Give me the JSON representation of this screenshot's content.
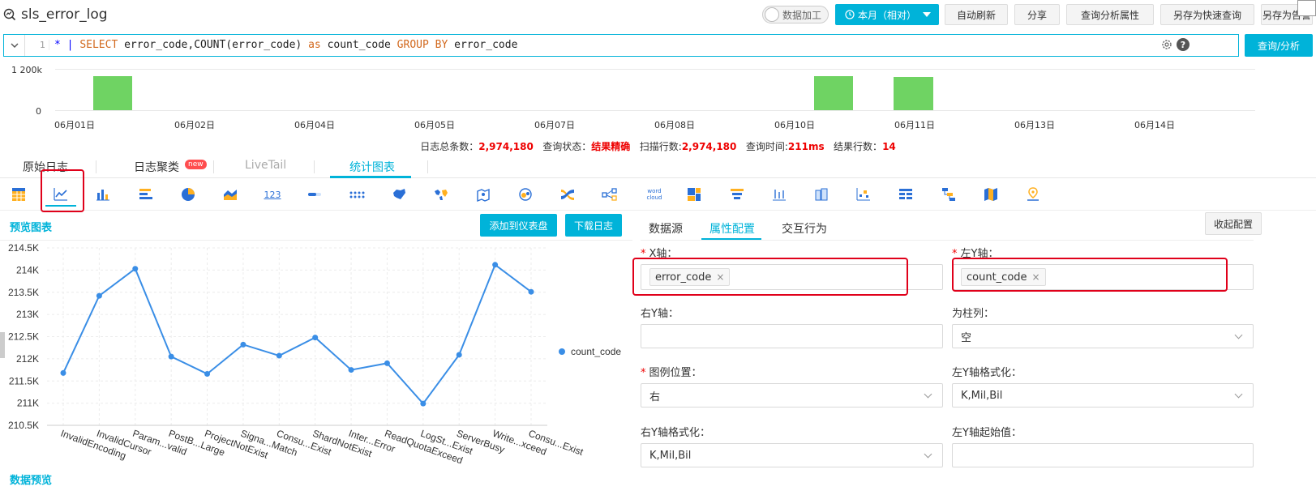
{
  "header": {
    "title": "sls_error_log",
    "toggle_label": "数据加工",
    "time_label": "本月（相对）",
    "buttons": [
      "自动刷新",
      "分享",
      "查询分析属性",
      "另存为快速查询",
      "另存为告警"
    ]
  },
  "query": {
    "line_number": "1",
    "parts": {
      "p1": "* | ",
      "p2": "SELECT",
      "p3": " error_code,COUNT(error_code) ",
      "p4": "as",
      "p5": " count_code ",
      "p6": "GROUP BY",
      "p7": " error_code"
    },
    "help": "?",
    "submit_label": "查询/分析"
  },
  "histogram": {
    "y_labels": [
      "1 200k",
      "0"
    ],
    "x_labels": [
      "06月01日",
      "06月02日",
      "06月04日",
      "06月05日",
      "06月07日",
      "06月08日",
      "06月10日",
      "06月11日",
      "06月13日",
      "06月14日"
    ]
  },
  "stats": {
    "total_label": "日志总条数：",
    "total_value": "2,974,180",
    "status_label": "查询状态：",
    "status_value": "结果精确",
    "scan_label": "扫描行数:",
    "scan_value": "2,974,180",
    "time_label": "查询时间:",
    "time_value": "211ms",
    "rows_label": "结果行数：",
    "rows_value": "14"
  },
  "tabs": {
    "raw": "原始日志",
    "cluster": "日志聚类",
    "cluster_badge": "new",
    "livetail": "LiveTail",
    "charts": "统计图表"
  },
  "chart_type_icons": {
    "number_icon_text": "123",
    "wordcloud_icon_text": "word cloud"
  },
  "preview": {
    "title": "预览图表",
    "add_dashboard": "添加到仪表盘",
    "download_log": "下载日志",
    "data_preview": "数据预览"
  },
  "chart_data": {
    "type": "line",
    "categories": [
      "InvalidEncoding",
      "InvalidCursor",
      "Param...valid",
      "PostB...Large",
      "ProjectNotExist",
      "Signa...Match",
      "Consu...Exist",
      "ShardNotExist",
      "Inter...Error",
      "ReadQuotaExceed",
      "LogSt...Exist",
      "ServerBusy",
      "Write...xceed",
      "Consu...Exist"
    ],
    "y_ticks": [
      "214.5K",
      "214K",
      "213.5K",
      "213K",
      "212.5K",
      "212K",
      "211.5K",
      "211K",
      "210.5K"
    ],
    "ylim": [
      210500,
      214500
    ],
    "series": [
      {
        "name": "count_code",
        "values": [
          211680,
          213420,
          214030,
          212050,
          211660,
          212320,
          212070,
          212480,
          211750,
          211900,
          210990,
          212090,
          214120,
          213510
        ]
      }
    ],
    "legend_position": "right",
    "color": "#3a8ee6",
    "grid": true
  },
  "config": {
    "tabs": [
      "数据源",
      "属性配置",
      "交互行为"
    ],
    "collapse": "收起配置",
    "x_axis_label": "X轴：",
    "x_axis_value": "error_code",
    "left_y_label": "左Y轴：",
    "left_y_value": "count_code",
    "right_y_label": "右Y轴：",
    "column_label": "为柱列：",
    "column_value": "空",
    "legend_label": "图例位置：",
    "legend_value": "右",
    "left_y_format_label": "左Y轴格式化：",
    "left_y_format_value": "K,Mil,Bil",
    "right_y_format_label": "右Y轴格式化：",
    "right_y_format_value": "K,Mil,Bil",
    "left_y_start_label": "左Y轴起始值："
  }
}
